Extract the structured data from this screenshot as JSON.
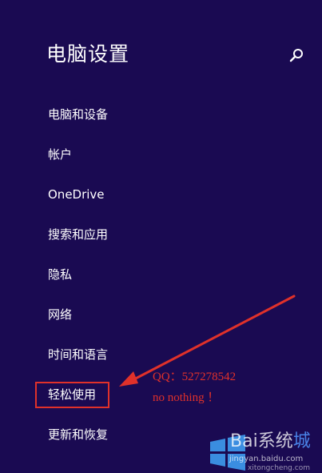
{
  "header": {
    "title": "电脑设置",
    "search_icon": "search-icon"
  },
  "nav": {
    "items": [
      {
        "label": "电脑和设备"
      },
      {
        "label": "帐户"
      },
      {
        "label": "OneDrive"
      },
      {
        "label": "搜索和应用"
      },
      {
        "label": "隐私"
      },
      {
        "label": "网络"
      },
      {
        "label": "时间和语言"
      },
      {
        "label": "轻松使用"
      },
      {
        "label": "更新和恢复"
      }
    ]
  },
  "annotation": {
    "qq": "QQ：527278542",
    "note": "no nothing ！",
    "color": "#e0312a"
  },
  "watermark": {
    "brand_left": "Bai",
    "brand_mid": "系统",
    "brand_right": "城",
    "url_top": "jingyan.baidu.com",
    "url_bottom": "xitongcheng.com"
  },
  "colors": {
    "background": "#1a0a52",
    "text": "#ffffff",
    "accent": "#e0312a"
  }
}
